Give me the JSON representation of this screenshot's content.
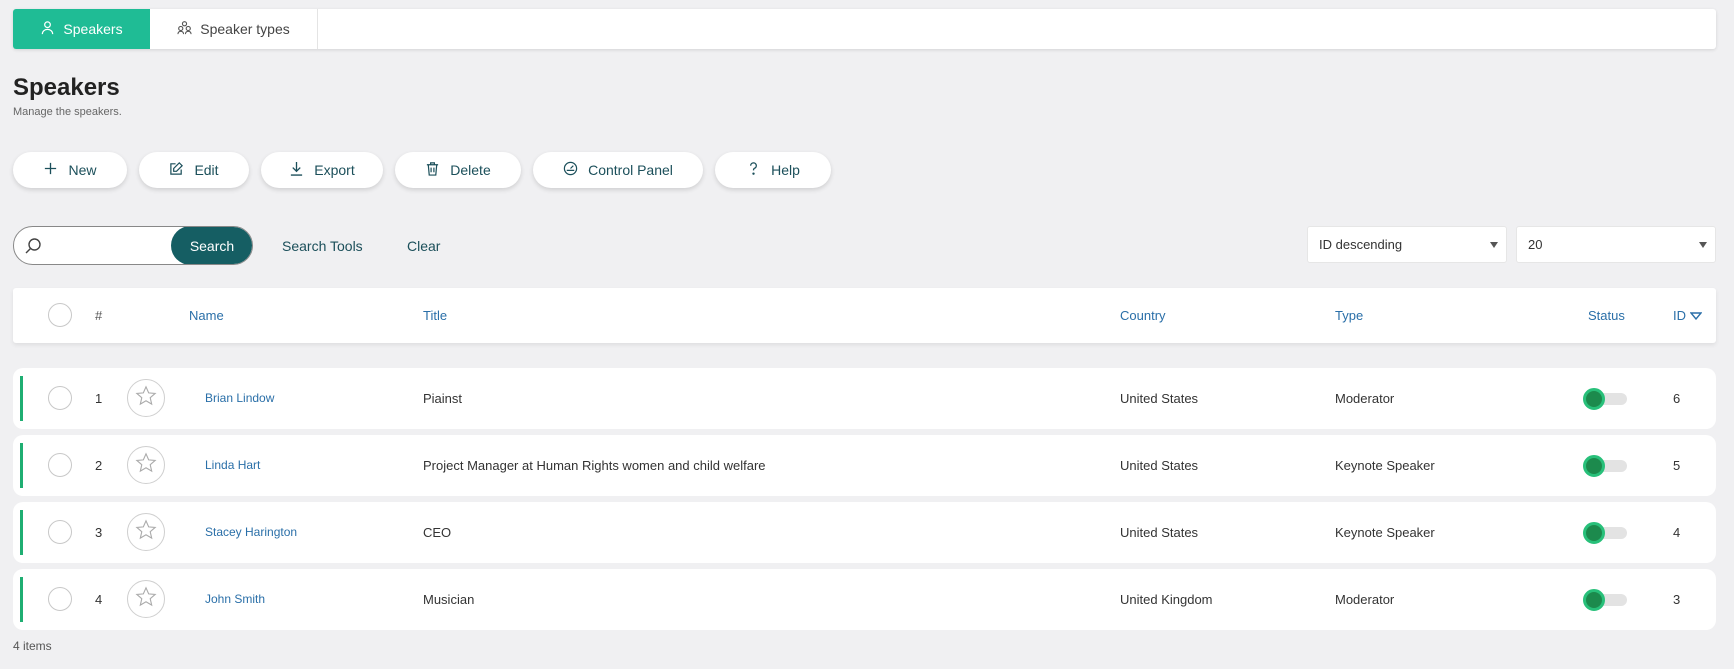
{
  "tabs": [
    {
      "label": "Speakers",
      "icon": "user-icon",
      "active": true
    },
    {
      "label": "Speaker types",
      "icon": "types-icon",
      "active": false
    }
  ],
  "page": {
    "title": "Speakers",
    "subtitle": "Manage the speakers."
  },
  "toolbar": {
    "new_label": "New",
    "edit_label": "Edit",
    "export_label": "Export",
    "delete_label": "Delete",
    "control_panel_label": "Control Panel",
    "help_label": "Help"
  },
  "search": {
    "value": "",
    "placeholder": "",
    "button_label": "Search",
    "tools_label": "Search Tools",
    "clear_label": "Clear"
  },
  "sort": {
    "selected": "ID descending"
  },
  "page_size": {
    "selected": "20"
  },
  "table": {
    "headers": {
      "index": "#",
      "name": "Name",
      "title": "Title",
      "country": "Country",
      "type": "Type",
      "status": "Status",
      "id": "ID"
    },
    "rows": [
      {
        "index": "1",
        "name": "Brian Lindow",
        "title": "Piainst",
        "country": "United States",
        "type": "Moderator",
        "status": "on",
        "id": "6"
      },
      {
        "index": "2",
        "name": "Linda Hart",
        "title": "Project Manager at Human Rights women and child welfare",
        "country": "United States",
        "type": "Keynote Speaker",
        "status": "on",
        "id": "5"
      },
      {
        "index": "3",
        "name": "Stacey Harington",
        "title": "CEO",
        "country": "United States",
        "type": "Keynote Speaker",
        "status": "on",
        "id": "4"
      },
      {
        "index": "4",
        "name": "John Smith",
        "title": "Musician",
        "country": "United Kingdom",
        "type": "Moderator",
        "status": "on",
        "id": "3"
      }
    ]
  },
  "footer": {
    "count_label": "4 items"
  },
  "colors": {
    "accent": "#1fbc95",
    "search_button": "#155e63",
    "link": "#2a6fa8",
    "status_on": "#1c8a4d"
  }
}
